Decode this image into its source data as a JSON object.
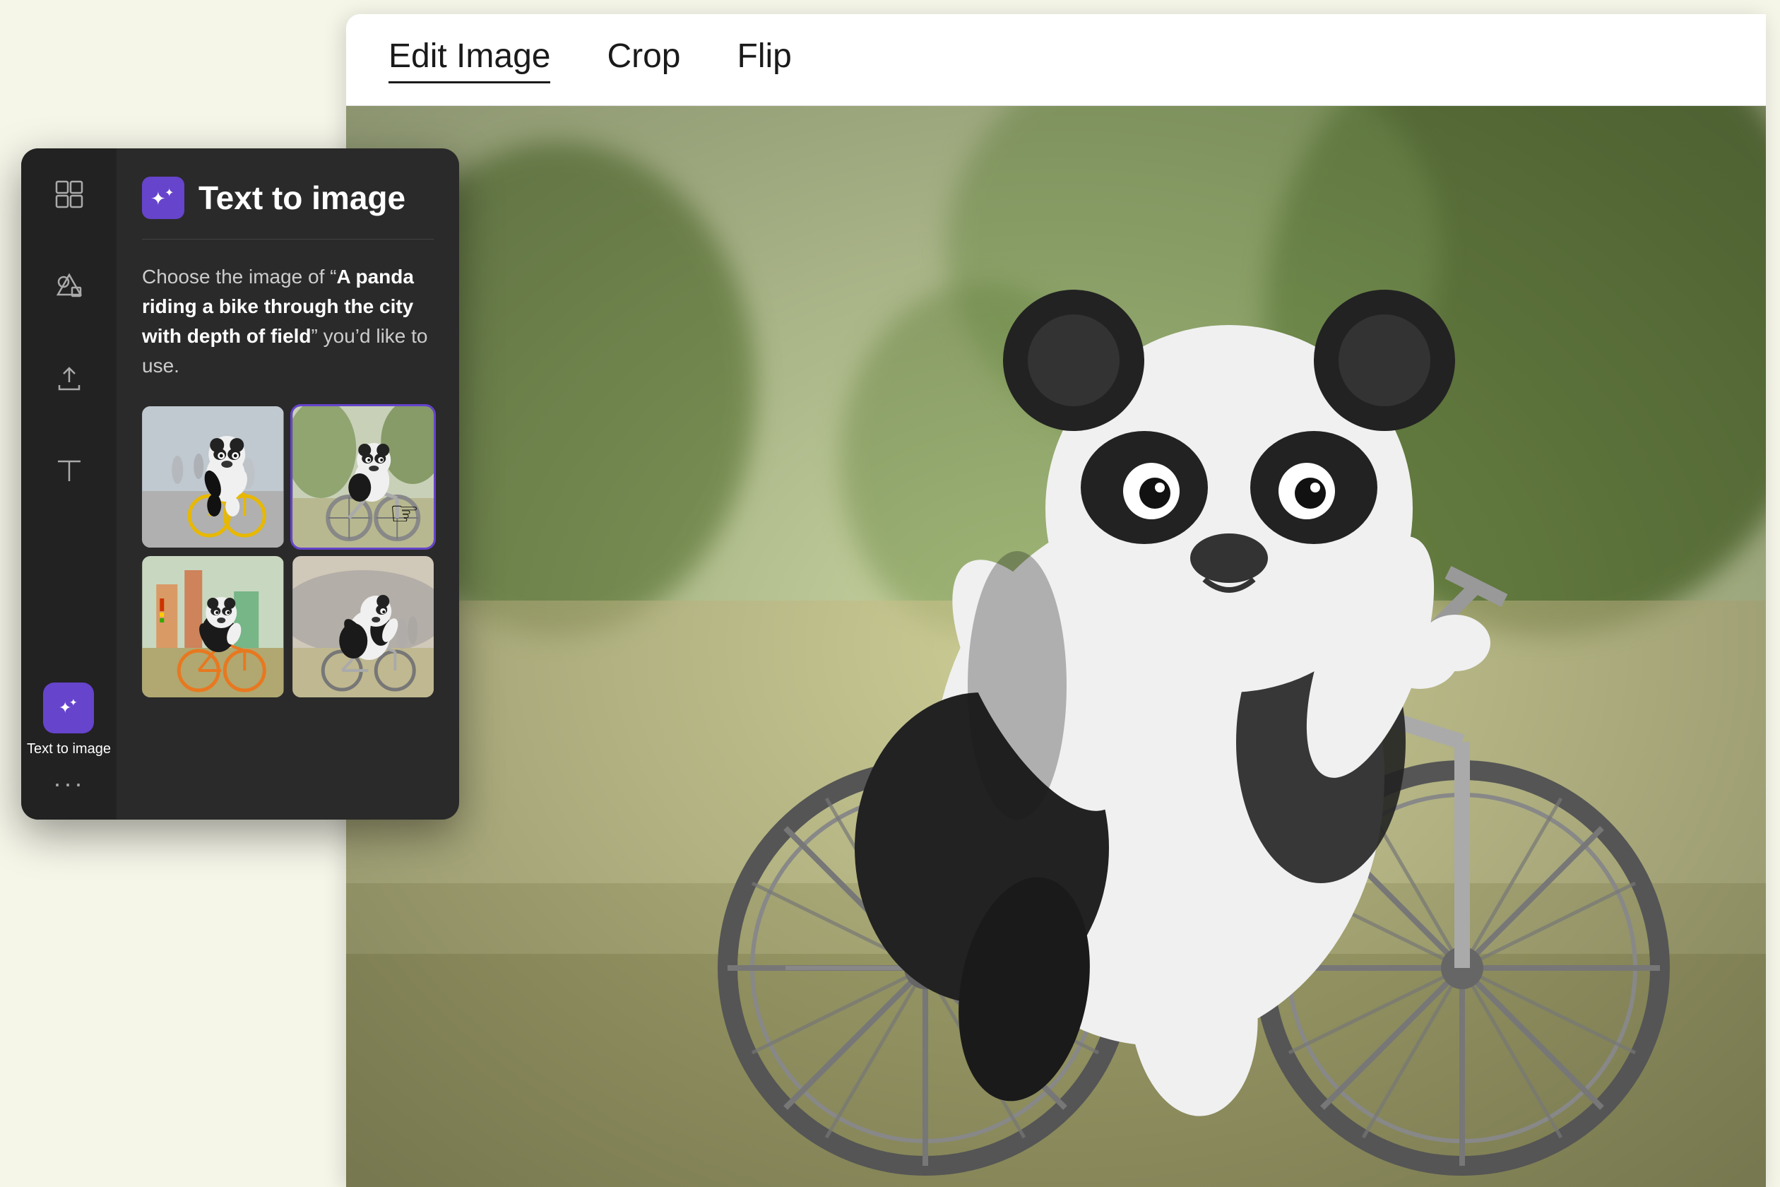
{
  "header": {
    "tabs": [
      {
        "id": "edit-image",
        "label": "Edit Image",
        "active": true
      },
      {
        "id": "crop",
        "label": "Crop",
        "active": false
      },
      {
        "id": "flip",
        "label": "Flip",
        "active": false
      }
    ]
  },
  "sidebar": {
    "icons": [
      {
        "id": "layout",
        "name": "layout-icon"
      },
      {
        "id": "shapes",
        "name": "shapes-icon"
      },
      {
        "id": "upload",
        "name": "upload-icon"
      },
      {
        "id": "text",
        "name": "text-icon"
      }
    ],
    "active_tool": {
      "icon_label": "Text to image",
      "label": "Text to image"
    },
    "more_label": "···"
  },
  "panel": {
    "title": "Text to image",
    "description_prefix": "Choose the image of “",
    "description_bold": "A panda riding a bike through the city with depth of field",
    "description_suffix": "” you’d like to use.",
    "images": [
      {
        "id": "img1",
        "alt": "Panda riding bike on street"
      },
      {
        "id": "img2",
        "alt": "Panda on scooter style bike"
      },
      {
        "id": "img3",
        "alt": "Panda on orange bike in city"
      },
      {
        "id": "img4",
        "alt": "Panda on bike side view"
      }
    ]
  },
  "colors": {
    "accent": "#6644cc",
    "sidebar_bg": "#2a2a2a",
    "icon_strip_bg": "#222222",
    "text_primary": "#ffffff",
    "text_secondary": "#cccccc"
  }
}
